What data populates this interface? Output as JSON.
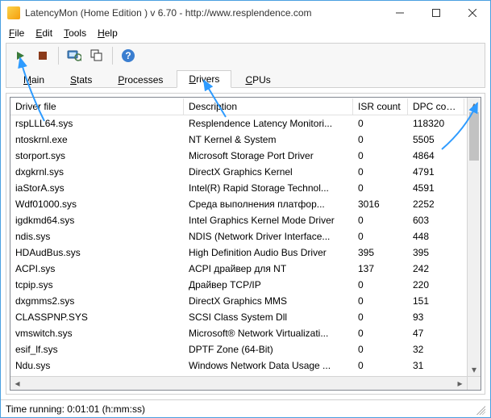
{
  "window": {
    "title": "LatencyMon  (Home Edition )  v 6.70 - http://www.resplendence.com"
  },
  "menu": {
    "file": "File",
    "edit": "Edit",
    "tools": "Tools",
    "help": "Help"
  },
  "tabs": {
    "main": "Main",
    "stats": "Stats",
    "processes": "Processes",
    "drivers": "Drivers",
    "cpus": "CPUs"
  },
  "columns": {
    "file": "Driver file",
    "desc": "Description",
    "isr": "ISR count",
    "dpc": "DPC count"
  },
  "rows": [
    {
      "file": "rspLLL64.sys",
      "desc": "Resplendence Latency Monitori...",
      "isr": "0",
      "dpc": "118320"
    },
    {
      "file": "ntoskrnl.exe",
      "desc": "NT Kernel & System",
      "isr": "0",
      "dpc": "5505"
    },
    {
      "file": "storport.sys",
      "desc": "Microsoft Storage Port Driver",
      "isr": "0",
      "dpc": "4864"
    },
    {
      "file": "dxgkrnl.sys",
      "desc": "DirectX Graphics Kernel",
      "isr": "0",
      "dpc": "4791"
    },
    {
      "file": "iaStorA.sys",
      "desc": "Intel(R) Rapid Storage Technol...",
      "isr": "0",
      "dpc": "4591"
    },
    {
      "file": "Wdf01000.sys",
      "desc": "Среда выполнения платфор...",
      "isr": "3016",
      "dpc": "2252"
    },
    {
      "file": "igdkmd64.sys",
      "desc": "Intel Graphics Kernel Mode Driver",
      "isr": "0",
      "dpc": "603"
    },
    {
      "file": "ndis.sys",
      "desc": "NDIS (Network Driver Interface...",
      "isr": "0",
      "dpc": "448"
    },
    {
      "file": "HDAudBus.sys",
      "desc": "High Definition Audio Bus Driver",
      "isr": "395",
      "dpc": "395"
    },
    {
      "file": "ACPI.sys",
      "desc": "ACPI драйвер для NT",
      "isr": "137",
      "dpc": "242"
    },
    {
      "file": "tcpip.sys",
      "desc": "Драйвер TCP/IP",
      "isr": "0",
      "dpc": "220"
    },
    {
      "file": "dxgmms2.sys",
      "desc": "DirectX Graphics MMS",
      "isr": "0",
      "dpc": "151"
    },
    {
      "file": "CLASSPNP.SYS",
      "desc": "SCSI Class System Dll",
      "isr": "0",
      "dpc": "93"
    },
    {
      "file": "vmswitch.sys",
      "desc": "Microsoft® Network Virtualizati...",
      "isr": "0",
      "dpc": "47"
    },
    {
      "file": "esif_lf.sys",
      "desc": "DPTF Zone (64-Bit)",
      "isr": "0",
      "dpc": "32"
    },
    {
      "file": "Ndu.sys",
      "desc": "Windows Network Data Usage ...",
      "isr": "0",
      "dpc": "31"
    }
  ],
  "status": {
    "text": "Time running: 0:01:01  (h:mm:ss)"
  }
}
